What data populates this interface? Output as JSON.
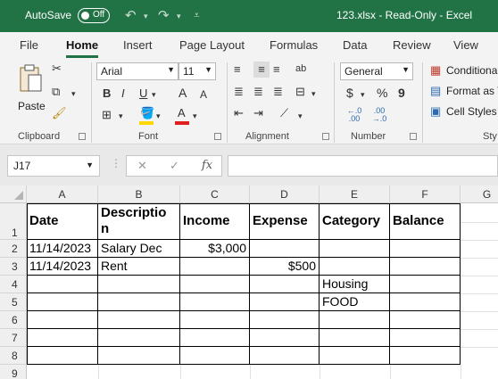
{
  "titlebar": {
    "autosave_label": "AutoSave",
    "autosave_state": "Off",
    "file_status": "123.xlsx  -  Read-Only  -  Excel"
  },
  "tabs": [
    "File",
    "Home",
    "Insert",
    "Page Layout",
    "Formulas",
    "Data",
    "Review",
    "View"
  ],
  "active_tab": "Home",
  "ribbon": {
    "clipboard": {
      "label": "Clipboard",
      "paste_label": "Paste"
    },
    "font": {
      "label": "Font",
      "font_name": "Arial",
      "font_size": "11",
      "bold": "B",
      "italic": "I",
      "underline": "U",
      "grow": "A",
      "shrink": "A",
      "font_color_letter": "A",
      "highlight_color": "#ffd800",
      "font_color": "#e02020"
    },
    "alignment": {
      "label": "Alignment",
      "wrap_icon": "ab"
    },
    "number": {
      "label": "Number",
      "format": "General",
      "currency": "$",
      "percent": "%",
      "comma": "9",
      "inc_decimal": "←.0 .00",
      "dec_decimal": ".00 →.0"
    },
    "styles": {
      "conditional": "Conditiona",
      "format_as": "Format as T",
      "cell_styles": "Cell Styles",
      "label_partial": "Sty"
    }
  },
  "formula_bar": {
    "name_box": "J17",
    "fx": "fx",
    "cancel": "✕",
    "enter": "✓",
    "content": ""
  },
  "sheet": {
    "columns": [
      "A",
      "B",
      "C",
      "D",
      "E",
      "F",
      "G"
    ],
    "rows": [
      "1",
      "2",
      "3",
      "4",
      "5",
      "6",
      "7",
      "8",
      "9"
    ],
    "headers": {
      "a": "Date",
      "b_line1": "Descriptio",
      "b_line2": "n",
      "c": "Income",
      "d": "Expense",
      "e": "Category",
      "f": "Balance"
    },
    "row2": {
      "date": "11/14/2023",
      "description": "Salary Dec",
      "income": "$3,000"
    },
    "row3": {
      "date": "11/14/2023",
      "description": "Rent",
      "expense": "$500"
    },
    "row4": {
      "category": "Housing"
    },
    "row5": {
      "category": "FOOD"
    }
  },
  "colors": {
    "excel_green": "#217346",
    "ribbon_bg": "#f3f3f3",
    "header_bg": "#efefef"
  }
}
